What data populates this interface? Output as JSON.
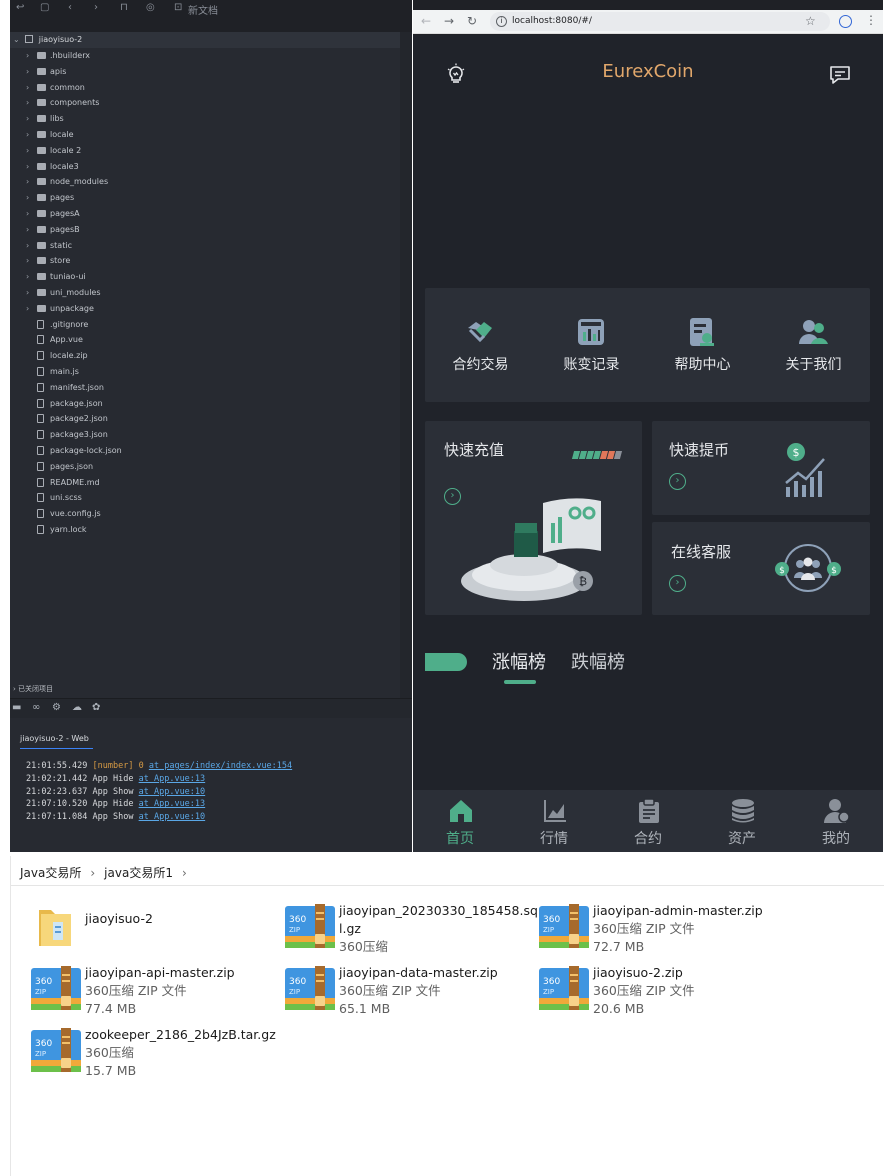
{
  "ide": {
    "toolbar_label": "新文档",
    "tree_root": "jiaoyisuo-2",
    "tree": [
      {
        "name": ".hbuilderx",
        "kind": "folder"
      },
      {
        "name": "apis",
        "kind": "folder"
      },
      {
        "name": "common",
        "kind": "folder"
      },
      {
        "name": "components",
        "kind": "folder"
      },
      {
        "name": "libs",
        "kind": "folder"
      },
      {
        "name": "locale",
        "kind": "folder"
      },
      {
        "name": "locale 2",
        "kind": "folder"
      },
      {
        "name": "locale3",
        "kind": "folder"
      },
      {
        "name": "node_modules",
        "kind": "folder"
      },
      {
        "name": "pages",
        "kind": "folder"
      },
      {
        "name": "pagesA",
        "kind": "folder"
      },
      {
        "name": "pagesB",
        "kind": "folder"
      },
      {
        "name": "static",
        "kind": "folder"
      },
      {
        "name": "store",
        "kind": "folder"
      },
      {
        "name": "tuniao-ui",
        "kind": "folder"
      },
      {
        "name": "uni_modules",
        "kind": "folder"
      },
      {
        "name": "unpackage",
        "kind": "folder"
      },
      {
        "name": ".gitignore",
        "kind": "file"
      },
      {
        "name": "App.vue",
        "kind": "file"
      },
      {
        "name": "locale.zip",
        "kind": "file"
      },
      {
        "name": "main.js",
        "kind": "file"
      },
      {
        "name": "manifest.json",
        "kind": "file"
      },
      {
        "name": "package.json",
        "kind": "file"
      },
      {
        "name": "package2.json",
        "kind": "file"
      },
      {
        "name": "package3.json",
        "kind": "file"
      },
      {
        "name": "package-lock.json",
        "kind": "file"
      },
      {
        "name": "pages.json",
        "kind": "file"
      },
      {
        "name": "README.md",
        "kind": "file"
      },
      {
        "name": "uni.scss",
        "kind": "file"
      },
      {
        "name": "vue.config.js",
        "kind": "file"
      },
      {
        "name": "yarn.lock",
        "kind": "file"
      }
    ],
    "closed_projects": "已关闭项目",
    "console_tab": "jiaoyisuo-2 - Web",
    "console_lines": [
      {
        "time": "21:01:55.429",
        "text": "[number] 0",
        "link": "at pages/index/index.vue:154",
        "numeric": true
      },
      {
        "time": "21:02:21.442",
        "text": "App Hide",
        "link": "at App.vue:13",
        "numeric": false
      },
      {
        "time": "21:02:23.637",
        "text": "App Show",
        "link": "at App.vue:10",
        "numeric": false
      },
      {
        "time": "21:07:10.520",
        "text": "App Hide",
        "link": "at App.vue:13",
        "numeric": false
      },
      {
        "time": "21:07:11.084",
        "text": "App Show",
        "link": "at App.vue:10",
        "numeric": false
      }
    ]
  },
  "browser": {
    "url": "localhost:8080/#/"
  },
  "app": {
    "title": "EurexCoin",
    "accent": "#4fae8a",
    "title_color": "#e1a76b",
    "quick_nav": [
      {
        "label": "合约交易",
        "icon": "handshake-icon"
      },
      {
        "label": "账变记录",
        "icon": "ledger-icon"
      },
      {
        "label": "帮助中心",
        "icon": "help-doc-icon"
      },
      {
        "label": "关于我们",
        "icon": "users-icon"
      }
    ],
    "cards": {
      "recharge": "快速充值",
      "withdraw": "快速提币",
      "support": "在线客服"
    },
    "rank_tabs": [
      "涨幅榜",
      "跌幅榜"
    ],
    "tabbar": [
      {
        "label": "首页",
        "icon": "home-icon",
        "active": true
      },
      {
        "label": "行情",
        "icon": "chart-icon",
        "active": false
      },
      {
        "label": "合约",
        "icon": "contract-icon",
        "active": false
      },
      {
        "label": "资产",
        "icon": "coins-icon",
        "active": false
      },
      {
        "label": "我的",
        "icon": "profile-icon",
        "active": false
      }
    ]
  },
  "explorer": {
    "breadcrumb": [
      "Java交易所",
      "java交易所1"
    ],
    "files": [
      {
        "name": "jiaoyisuo-2",
        "type": "",
        "size": "",
        "kind": "folder"
      },
      {
        "name": "jiaoyipan_20230330_185458.sql.gz",
        "type": "360压缩",
        "size": "",
        "kind": "zip"
      },
      {
        "name": "jiaoyipan-admin-master.zip",
        "type": "360压缩 ZIP 文件",
        "size": "72.7 MB",
        "kind": "zip"
      },
      {
        "name": "jiaoyipan-api-master.zip",
        "type": "360压缩 ZIP 文件",
        "size": "77.4 MB",
        "kind": "zip"
      },
      {
        "name": "jiaoyipan-data-master.zip",
        "type": "360压缩 ZIP 文件",
        "size": "65.1 MB",
        "kind": "zip"
      },
      {
        "name": "jiaoyisuo-2.zip",
        "type": "360压缩 ZIP 文件",
        "size": "20.6 MB",
        "kind": "zip"
      },
      {
        "name": "zookeeper_2186_2b4JzB.tar.gz",
        "type": "360压缩",
        "size": "15.7 MB",
        "kind": "zip"
      }
    ],
    "zip_badge": "360",
    "zip_sub": "ZIP"
  }
}
